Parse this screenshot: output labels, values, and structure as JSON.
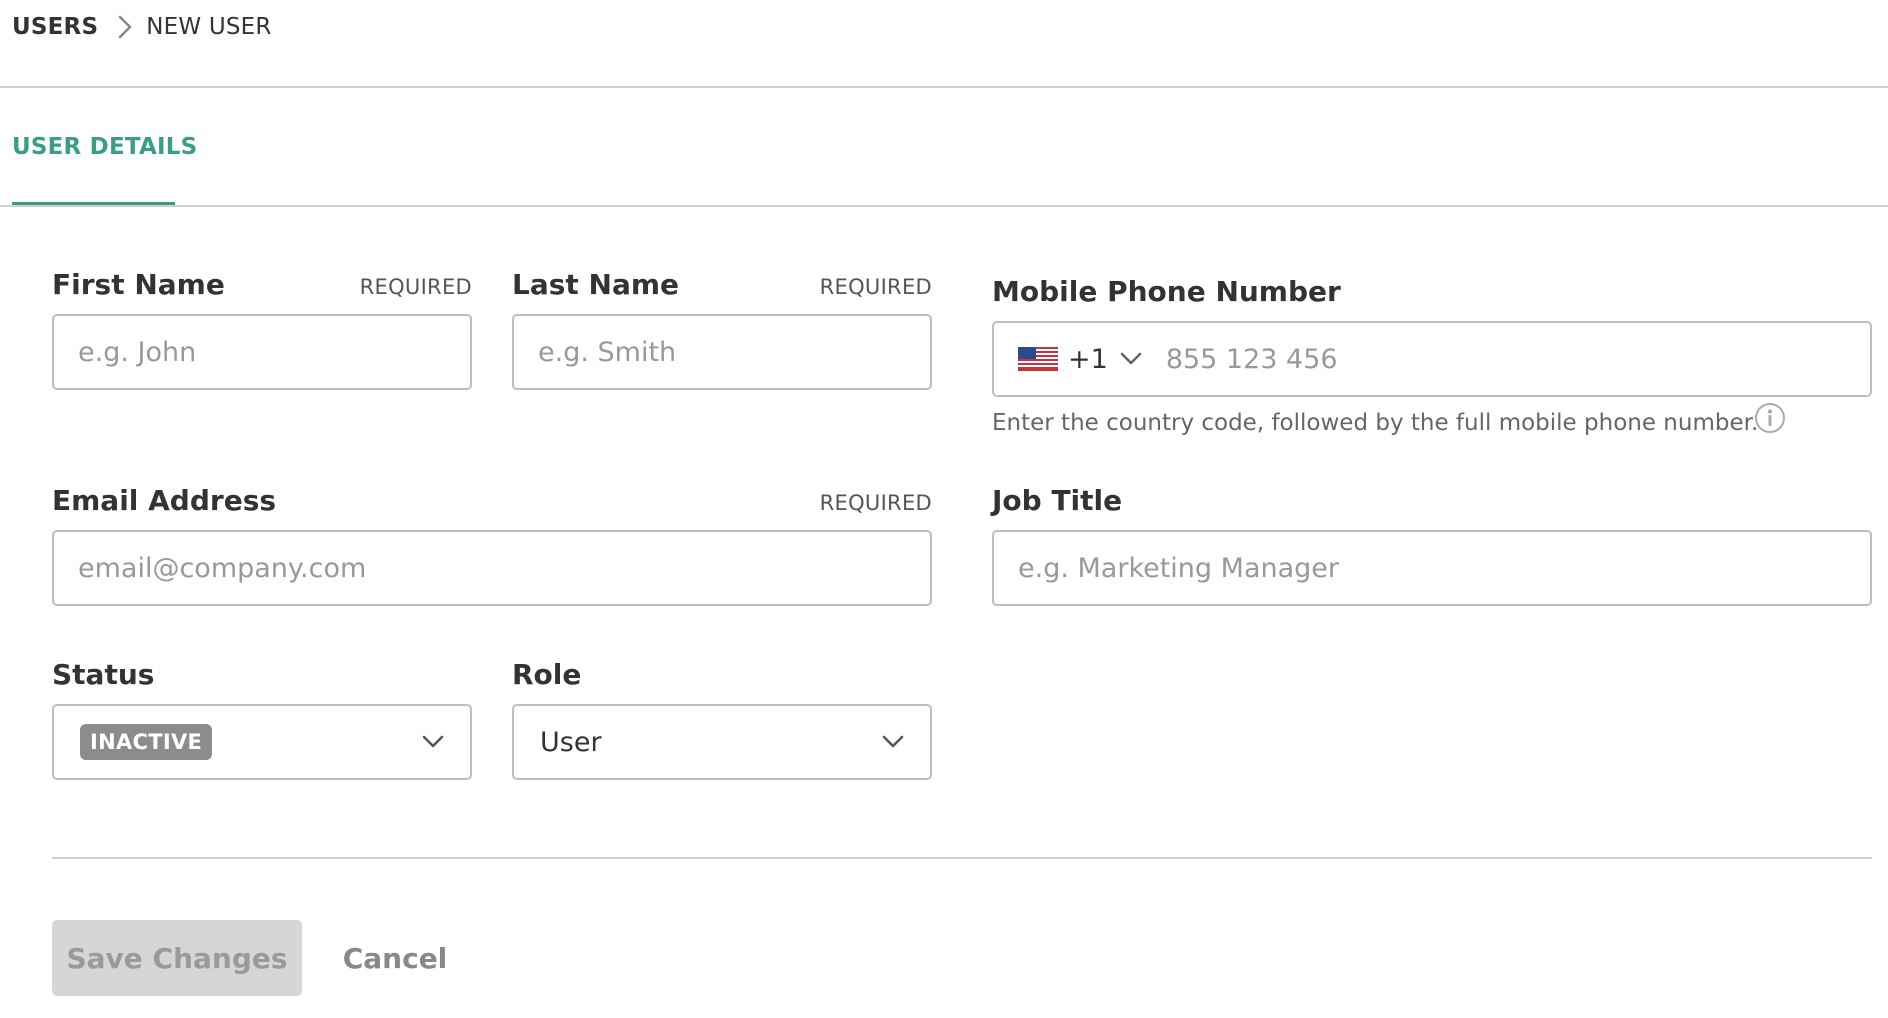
{
  "breadcrumb": {
    "parent": "USERS",
    "current": "NEW USER"
  },
  "tabs": [
    {
      "label": "USER DETAILS",
      "active": true
    }
  ],
  "accent_color": "#3a9e86",
  "form": {
    "first_name": {
      "label": "First Name",
      "required_text": "REQUIRED",
      "placeholder": "e.g. John",
      "value": ""
    },
    "last_name": {
      "label": "Last Name",
      "required_text": "REQUIRED",
      "placeholder": "e.g. Smith",
      "value": ""
    },
    "mobile_phone": {
      "label": "Mobile Phone Number",
      "country_flag": "us-flag-icon",
      "country_code": "+1",
      "placeholder": "855 123 456",
      "value": "",
      "hint": "Enter the country code, followed by the full mobile phone number."
    },
    "email": {
      "label": "Email Address",
      "required_text": "REQUIRED",
      "placeholder": "email@company.com",
      "value": ""
    },
    "job_title": {
      "label": "Job Title",
      "placeholder": "e.g. Marketing Manager",
      "value": ""
    },
    "status": {
      "label": "Status",
      "selected": "INACTIVE",
      "badge_color": "#8c8c8c"
    },
    "role": {
      "label": "Role",
      "selected": "User"
    }
  },
  "actions": {
    "save_label": "Save Changes",
    "cancel_label": "Cancel"
  }
}
